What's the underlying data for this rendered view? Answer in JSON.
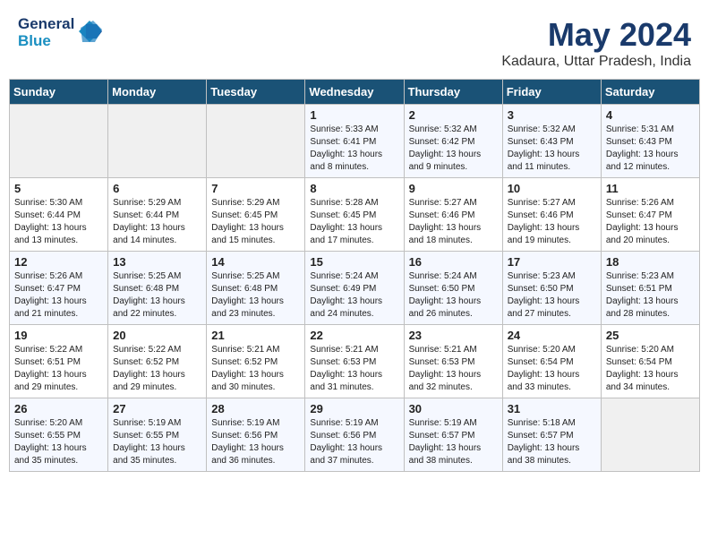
{
  "header": {
    "logo_line1": "General",
    "logo_line2": "Blue",
    "title": "May 2024",
    "subtitle": "Kadaura, Uttar Pradesh, India"
  },
  "weekdays": [
    "Sunday",
    "Monday",
    "Tuesday",
    "Wednesday",
    "Thursday",
    "Friday",
    "Saturday"
  ],
  "weeks": [
    [
      {
        "day": "",
        "info": ""
      },
      {
        "day": "",
        "info": ""
      },
      {
        "day": "",
        "info": ""
      },
      {
        "day": "1",
        "info": "Sunrise: 5:33 AM\nSunset: 6:41 PM\nDaylight: 13 hours\nand 8 minutes."
      },
      {
        "day": "2",
        "info": "Sunrise: 5:32 AM\nSunset: 6:42 PM\nDaylight: 13 hours\nand 9 minutes."
      },
      {
        "day": "3",
        "info": "Sunrise: 5:32 AM\nSunset: 6:43 PM\nDaylight: 13 hours\nand 11 minutes."
      },
      {
        "day": "4",
        "info": "Sunrise: 5:31 AM\nSunset: 6:43 PM\nDaylight: 13 hours\nand 12 minutes."
      }
    ],
    [
      {
        "day": "5",
        "info": "Sunrise: 5:30 AM\nSunset: 6:44 PM\nDaylight: 13 hours\nand 13 minutes."
      },
      {
        "day": "6",
        "info": "Sunrise: 5:29 AM\nSunset: 6:44 PM\nDaylight: 13 hours\nand 14 minutes."
      },
      {
        "day": "7",
        "info": "Sunrise: 5:29 AM\nSunset: 6:45 PM\nDaylight: 13 hours\nand 15 minutes."
      },
      {
        "day": "8",
        "info": "Sunrise: 5:28 AM\nSunset: 6:45 PM\nDaylight: 13 hours\nand 17 minutes."
      },
      {
        "day": "9",
        "info": "Sunrise: 5:27 AM\nSunset: 6:46 PM\nDaylight: 13 hours\nand 18 minutes."
      },
      {
        "day": "10",
        "info": "Sunrise: 5:27 AM\nSunset: 6:46 PM\nDaylight: 13 hours\nand 19 minutes."
      },
      {
        "day": "11",
        "info": "Sunrise: 5:26 AM\nSunset: 6:47 PM\nDaylight: 13 hours\nand 20 minutes."
      }
    ],
    [
      {
        "day": "12",
        "info": "Sunrise: 5:26 AM\nSunset: 6:47 PM\nDaylight: 13 hours\nand 21 minutes."
      },
      {
        "day": "13",
        "info": "Sunrise: 5:25 AM\nSunset: 6:48 PM\nDaylight: 13 hours\nand 22 minutes."
      },
      {
        "day": "14",
        "info": "Sunrise: 5:25 AM\nSunset: 6:48 PM\nDaylight: 13 hours\nand 23 minutes."
      },
      {
        "day": "15",
        "info": "Sunrise: 5:24 AM\nSunset: 6:49 PM\nDaylight: 13 hours\nand 24 minutes."
      },
      {
        "day": "16",
        "info": "Sunrise: 5:24 AM\nSunset: 6:50 PM\nDaylight: 13 hours\nand 26 minutes."
      },
      {
        "day": "17",
        "info": "Sunrise: 5:23 AM\nSunset: 6:50 PM\nDaylight: 13 hours\nand 27 minutes."
      },
      {
        "day": "18",
        "info": "Sunrise: 5:23 AM\nSunset: 6:51 PM\nDaylight: 13 hours\nand 28 minutes."
      }
    ],
    [
      {
        "day": "19",
        "info": "Sunrise: 5:22 AM\nSunset: 6:51 PM\nDaylight: 13 hours\nand 29 minutes."
      },
      {
        "day": "20",
        "info": "Sunrise: 5:22 AM\nSunset: 6:52 PM\nDaylight: 13 hours\nand 29 minutes."
      },
      {
        "day": "21",
        "info": "Sunrise: 5:21 AM\nSunset: 6:52 PM\nDaylight: 13 hours\nand 30 minutes."
      },
      {
        "day": "22",
        "info": "Sunrise: 5:21 AM\nSunset: 6:53 PM\nDaylight: 13 hours\nand 31 minutes."
      },
      {
        "day": "23",
        "info": "Sunrise: 5:21 AM\nSunset: 6:53 PM\nDaylight: 13 hours\nand 32 minutes."
      },
      {
        "day": "24",
        "info": "Sunrise: 5:20 AM\nSunset: 6:54 PM\nDaylight: 13 hours\nand 33 minutes."
      },
      {
        "day": "25",
        "info": "Sunrise: 5:20 AM\nSunset: 6:54 PM\nDaylight: 13 hours\nand 34 minutes."
      }
    ],
    [
      {
        "day": "26",
        "info": "Sunrise: 5:20 AM\nSunset: 6:55 PM\nDaylight: 13 hours\nand 35 minutes."
      },
      {
        "day": "27",
        "info": "Sunrise: 5:19 AM\nSunset: 6:55 PM\nDaylight: 13 hours\nand 35 minutes."
      },
      {
        "day": "28",
        "info": "Sunrise: 5:19 AM\nSunset: 6:56 PM\nDaylight: 13 hours\nand 36 minutes."
      },
      {
        "day": "29",
        "info": "Sunrise: 5:19 AM\nSunset: 6:56 PM\nDaylight: 13 hours\nand 37 minutes."
      },
      {
        "day": "30",
        "info": "Sunrise: 5:19 AM\nSunset: 6:57 PM\nDaylight: 13 hours\nand 38 minutes."
      },
      {
        "day": "31",
        "info": "Sunrise: 5:18 AM\nSunset: 6:57 PM\nDaylight: 13 hours\nand 38 minutes."
      },
      {
        "day": "",
        "info": ""
      }
    ]
  ]
}
